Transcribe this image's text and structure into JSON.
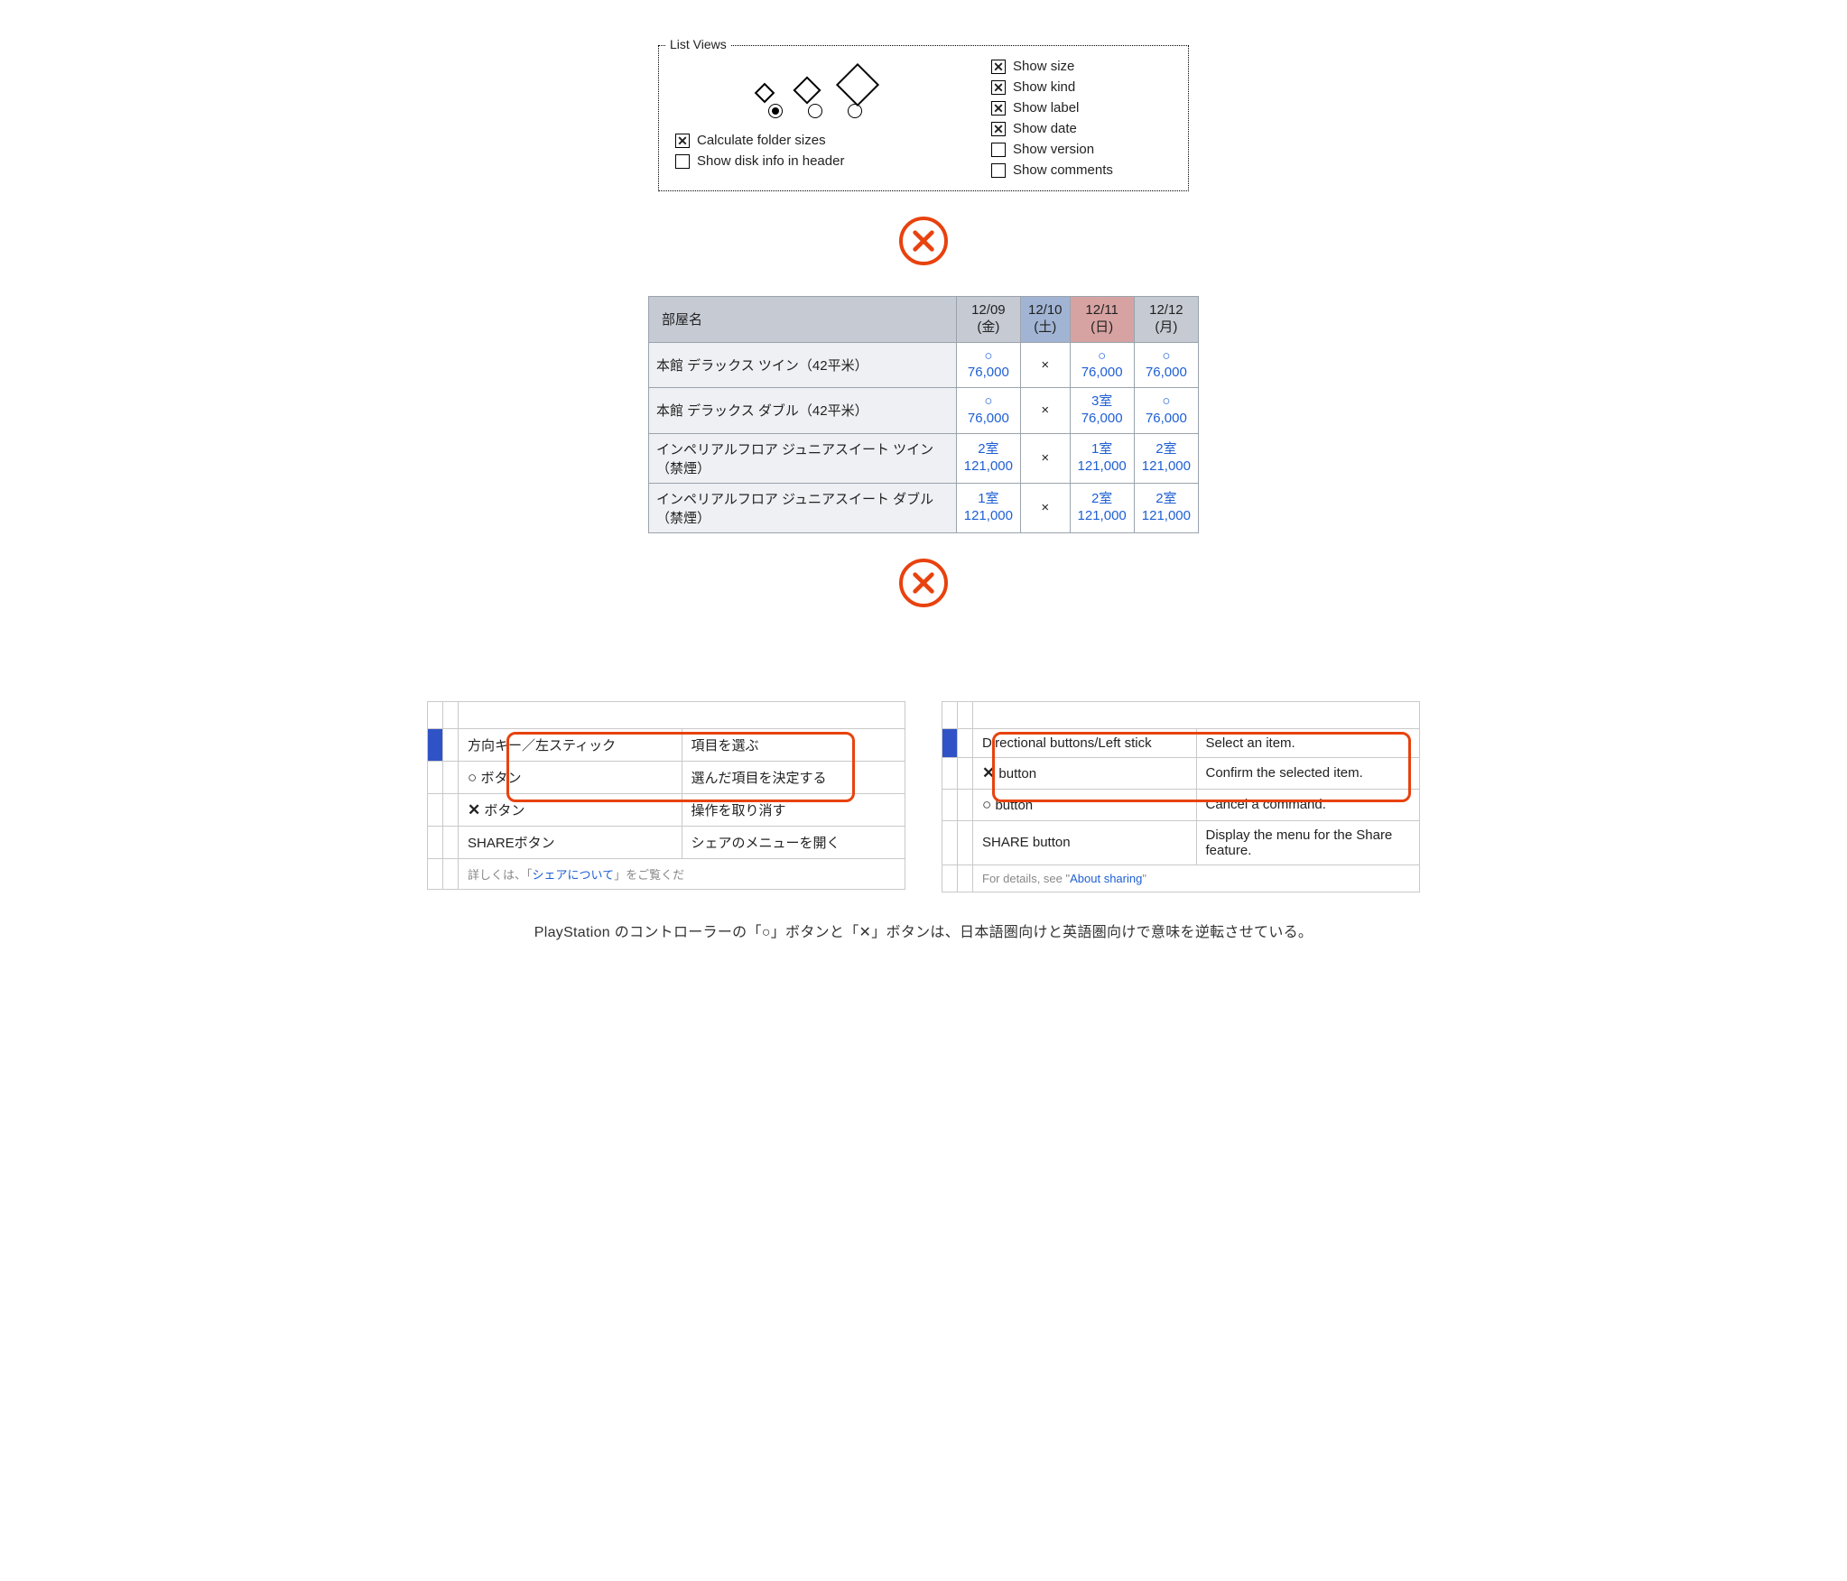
{
  "fig1": {
    "legend": "List Views",
    "calc_folder": "Calculate folder sizes",
    "disk_info": "Show disk info in header",
    "show_size": "Show size",
    "show_kind": "Show kind",
    "show_label": "Show label",
    "show_date": "Show date",
    "show_version": "Show version",
    "show_comments": "Show comments",
    "checked": {
      "calc_folder": true,
      "disk_info": false,
      "show_size": true,
      "show_kind": true,
      "show_label": true,
      "show_date": true,
      "show_version": false,
      "show_comments": false
    },
    "radio_selected": 0
  },
  "fig2": {
    "header_room": "部屋名",
    "dates": [
      {
        "d": "12/09",
        "w": "(金)",
        "cls": ""
      },
      {
        "d": "12/10",
        "w": "(土)",
        "cls": "sat"
      },
      {
        "d": "12/11",
        "w": "(日)",
        "cls": "sun"
      },
      {
        "d": "12/12",
        "w": "(月)",
        "cls": ""
      }
    ],
    "rows": [
      {
        "name": "本館 デラックス ツイン（42平米）",
        "cells": [
          {
            "t": "○",
            "p": "76,000"
          },
          {
            "t": "×",
            "p": ""
          },
          {
            "t": "○",
            "p": "76,000"
          },
          {
            "t": "○",
            "p": "76,000"
          }
        ]
      },
      {
        "name": "本館 デラックス ダブル（42平米）",
        "cells": [
          {
            "t": "○",
            "p": "76,000"
          },
          {
            "t": "×",
            "p": ""
          },
          {
            "t": "3室",
            "p": "76,000"
          },
          {
            "t": "○",
            "p": "76,000"
          }
        ]
      },
      {
        "name": "インペリアルフロア ジュニアスイート ツイン（禁煙）",
        "cells": [
          {
            "t": "2室",
            "p": "121,000"
          },
          {
            "t": "×",
            "p": ""
          },
          {
            "t": "1室",
            "p": "121,000"
          },
          {
            "t": "2室",
            "p": "121,000"
          }
        ]
      },
      {
        "name": "インペリアルフロア ジュニアスイート ダブル（禁煙）",
        "cells": [
          {
            "t": "1室",
            "p": "121,000"
          },
          {
            "t": "×",
            "p": ""
          },
          {
            "t": "2室",
            "p": "121,000"
          },
          {
            "t": "2室",
            "p": "121,000"
          }
        ]
      }
    ]
  },
  "fig3": {
    "jp": {
      "rows": [
        {
          "bar": true,
          "k": "方向キー／左スティック",
          "v": "項目を選ぶ"
        },
        {
          "bar": false,
          "icon": "○",
          "k": "ボタン",
          "v": "選んだ項目を決定する"
        },
        {
          "bar": false,
          "icon": "✕",
          "k": "ボタン",
          "v": "操作を取り消す"
        },
        {
          "bar": false,
          "k": "SHAREボタン",
          "v": "シェアのメニューを開く"
        }
      ],
      "trunc_top": "",
      "trunc_bottom_pre": "詳しくは、「",
      "trunc_bottom_link": "シェアについて",
      "trunc_bottom_post": "」をご覧くだ"
    },
    "en": {
      "rows": [
        {
          "bar": true,
          "k": "Directional buttons/Left stick",
          "v": "Select an item."
        },
        {
          "bar": false,
          "icon": "✕",
          "k": "button",
          "v": "Confirm the selected item."
        },
        {
          "bar": false,
          "icon": "○",
          "k": "button",
          "v": "Cancel a command."
        },
        {
          "bar": false,
          "k": "SHARE button",
          "v": "Display the menu for the Share feature."
        }
      ],
      "trunc_bottom_pre": "For details, see \"",
      "trunc_bottom_link": "About sharing",
      "trunc_bottom_post": "\""
    }
  },
  "caption": "PlayStation のコントローラーの「○」ボタンと「✕」ボタンは、日本語圏向けと英語圏向けで意味を逆転させている。"
}
